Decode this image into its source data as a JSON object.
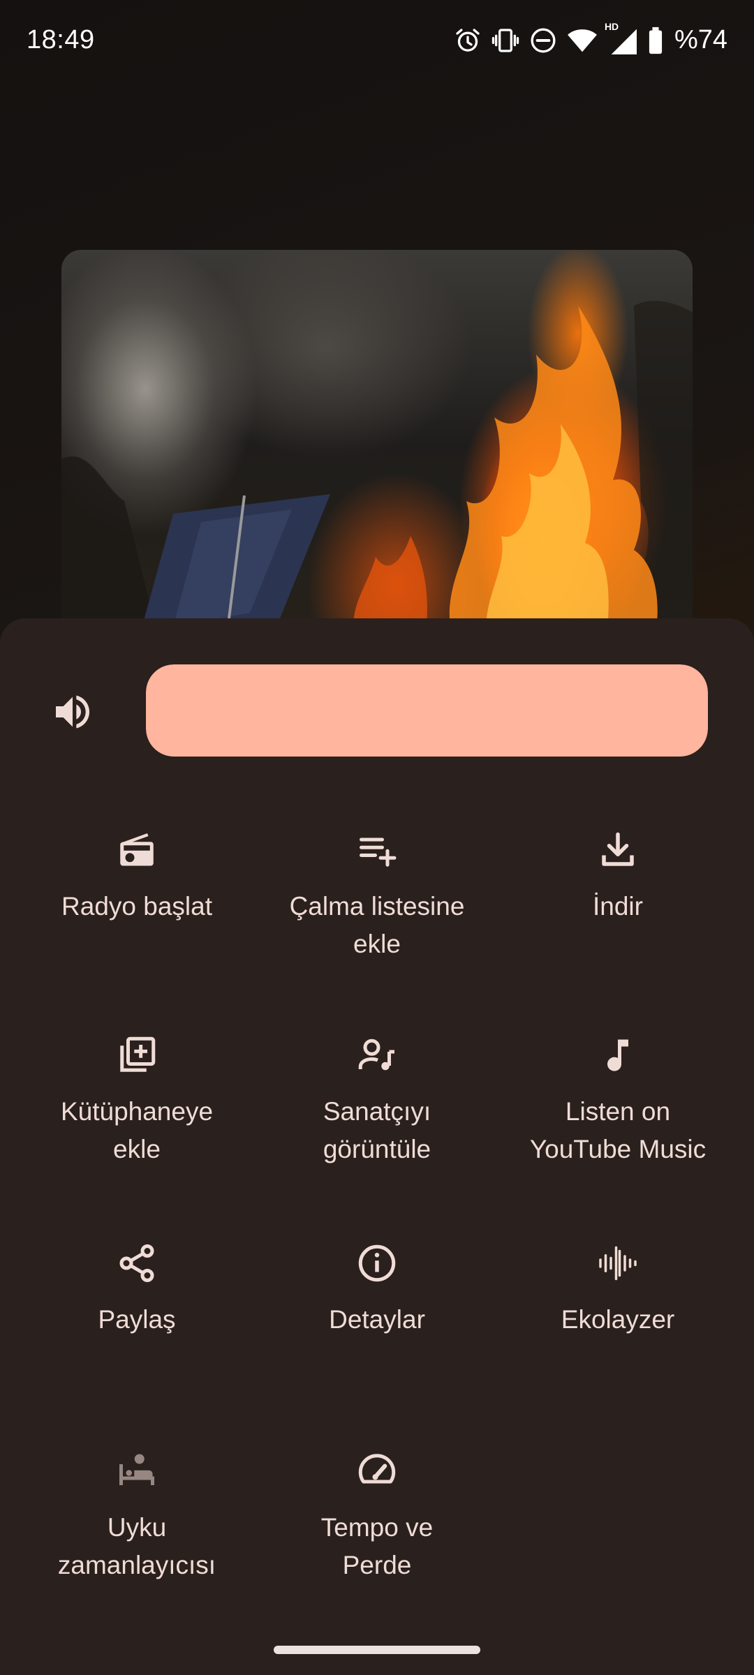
{
  "status_bar": {
    "time": "18:49",
    "icons": [
      "alarm-icon",
      "vibrate-icon",
      "do-not-disturb-icon",
      "wifi-icon",
      "hd-signal-icon",
      "battery-icon"
    ],
    "hd_label": "HD",
    "battery_percent": "%74"
  },
  "volume": {
    "icon": "volume-up-icon",
    "level": 1.0,
    "fill_color": "#ffb59e"
  },
  "menu": {
    "items": [
      {
        "id": "start-radio",
        "icon": "radio-icon",
        "label": "Radyo başlat"
      },
      {
        "id": "add-to-playlist",
        "icon": "playlist-add-icon",
        "label": "Çalma listesine ekle"
      },
      {
        "id": "download",
        "icon": "download-icon",
        "label": "İndir"
      },
      {
        "id": "add-to-library",
        "icon": "library-add-icon",
        "label": "Kütüphaneye ekle"
      },
      {
        "id": "view-artist",
        "icon": "artist-icon",
        "label": "Sanatçıyı görüntüle"
      },
      {
        "id": "listen-youtube-music",
        "icon": "music-note-icon",
        "label": "Listen on YouTube Music"
      },
      {
        "id": "share",
        "icon": "share-icon",
        "label": "Paylaş"
      },
      {
        "id": "details",
        "icon": "info-icon",
        "label": "Detaylar"
      },
      {
        "id": "equalizer",
        "icon": "equalizer-icon",
        "label": "Ekolayzer"
      },
      {
        "id": "sleep-timer",
        "icon": "sleep-timer-icon",
        "label": "Uyku zamanlayıcısı"
      },
      {
        "id": "tempo-pitch",
        "icon": "speed-icon",
        "label": "Tempo ve Perde"
      }
    ]
  },
  "colors": {
    "sheet_background": "#2a201e",
    "text": "#f0dcd6",
    "accent": "#ffb59e"
  }
}
